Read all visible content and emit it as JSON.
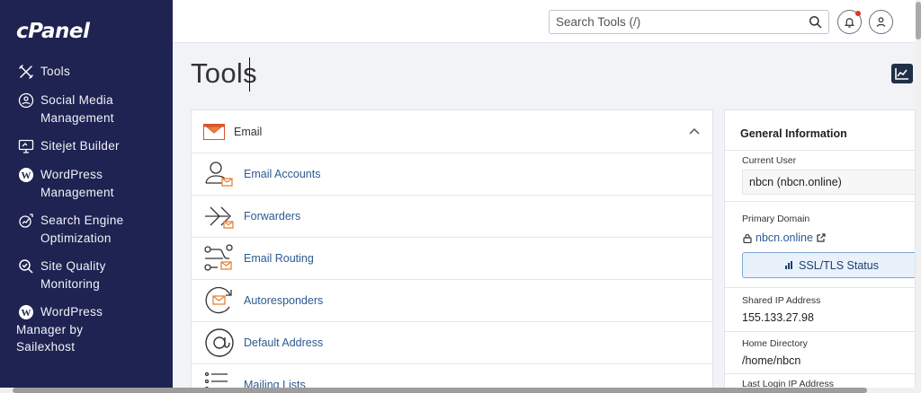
{
  "brand": {
    "logo_text": "cPanel"
  },
  "sidebar": {
    "items": [
      {
        "label": "Tools",
        "icon": "tools-icon"
      },
      {
        "label": "Social Media Management",
        "icon": "social-media-icon"
      },
      {
        "label": "Sitejet Builder",
        "icon": "sitejet-icon"
      },
      {
        "label": "WordPress Management",
        "icon": "wordpress-icon"
      },
      {
        "label": "Search Engine Optimization",
        "icon": "seo-icon"
      },
      {
        "label": "Site Quality Monitoring",
        "icon": "site-quality-icon"
      },
      {
        "label": "WordPress Manager by Sailexhost",
        "icon": "wordpress-icon"
      }
    ]
  },
  "header": {
    "search_placeholder": "Search Tools (/)",
    "notification_dot_color": "#e0352b"
  },
  "page": {
    "title": "Tools"
  },
  "email_panel": {
    "title": "Email",
    "tools": [
      {
        "label": "Email Accounts",
        "icon": "email-accounts-icon"
      },
      {
        "label": "Forwarders",
        "icon": "forwarders-icon"
      },
      {
        "label": "Email Routing",
        "icon": "email-routing-icon"
      },
      {
        "label": "Autoresponders",
        "icon": "autoresponders-icon"
      },
      {
        "label": "Default Address",
        "icon": "default-address-icon"
      },
      {
        "label": "Mailing Lists",
        "icon": "mailing-lists-icon"
      }
    ]
  },
  "general_info": {
    "title": "General Information",
    "current_user_label": "Current User",
    "current_user_value": "nbcn (nbcn.online)",
    "primary_domain_label": "Primary Domain",
    "primary_domain_value": "nbcn.online",
    "ssl_button_label": "SSL/TLS Status",
    "shared_ip_label": "Shared IP Address",
    "shared_ip_value": "155.133.27.98",
    "home_dir_label": "Home Directory",
    "home_dir_value": "/home/nbcn",
    "last_login_label": "Last Login IP Address"
  },
  "colors": {
    "sidebar_bg": "#1e2352",
    "link": "#2c5a91",
    "email_accent": "#e8833a"
  }
}
